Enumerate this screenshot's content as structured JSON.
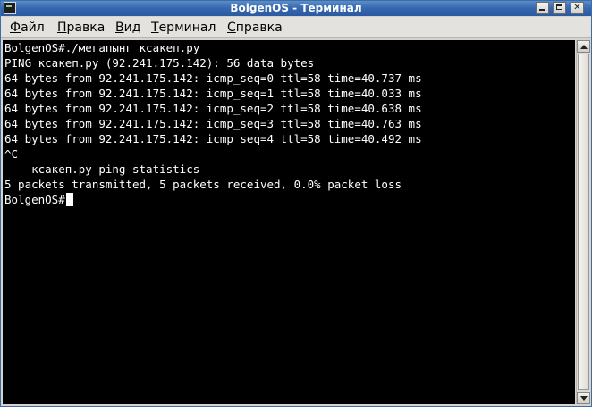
{
  "window": {
    "title": "BolgenOS - Терминал"
  },
  "menu": {
    "file": "Файл",
    "edit": "Правка",
    "view": "Вид",
    "terminal": "Терминал",
    "help": "Справка"
  },
  "terminal": {
    "lines": [
      "BolgenOS#./мегапынг ксакеп.ру",
      "PING ксакеп.ру (92.241.175.142): 56 data bytes",
      "64 bytes from 92.241.175.142: icmp_seq=0 ttl=58 time=40.737 ms",
      "64 bytes from 92.241.175.142: icmp_seq=1 ttl=58 time=40.033 ms",
      "64 bytes from 92.241.175.142: icmp_seq=2 ttl=58 time=40.638 ms",
      "64 bytes from 92.241.175.142: icmp_seq=3 ttl=58 time=40.763 ms",
      "64 bytes from 92.241.175.142: icmp_seq=4 ttl=58 time=40.492 ms",
      "^C",
      "--- ксакеп.ру ping statistics ---",
      "5 packets transmitted, 5 packets received, 0.0% packet loss"
    ],
    "prompt": "BolgenOS#"
  },
  "icons": {
    "app": "terminal-icon",
    "minimize": "minimize-icon",
    "maximize": "maximize-icon",
    "close": "close-icon",
    "scroll_up": "arrow-up-icon",
    "scroll_down": "arrow-down-icon"
  },
  "colors": {
    "titlebar": "#3467b0",
    "terminal_bg": "#000000",
    "terminal_fg": "#ffffff"
  }
}
